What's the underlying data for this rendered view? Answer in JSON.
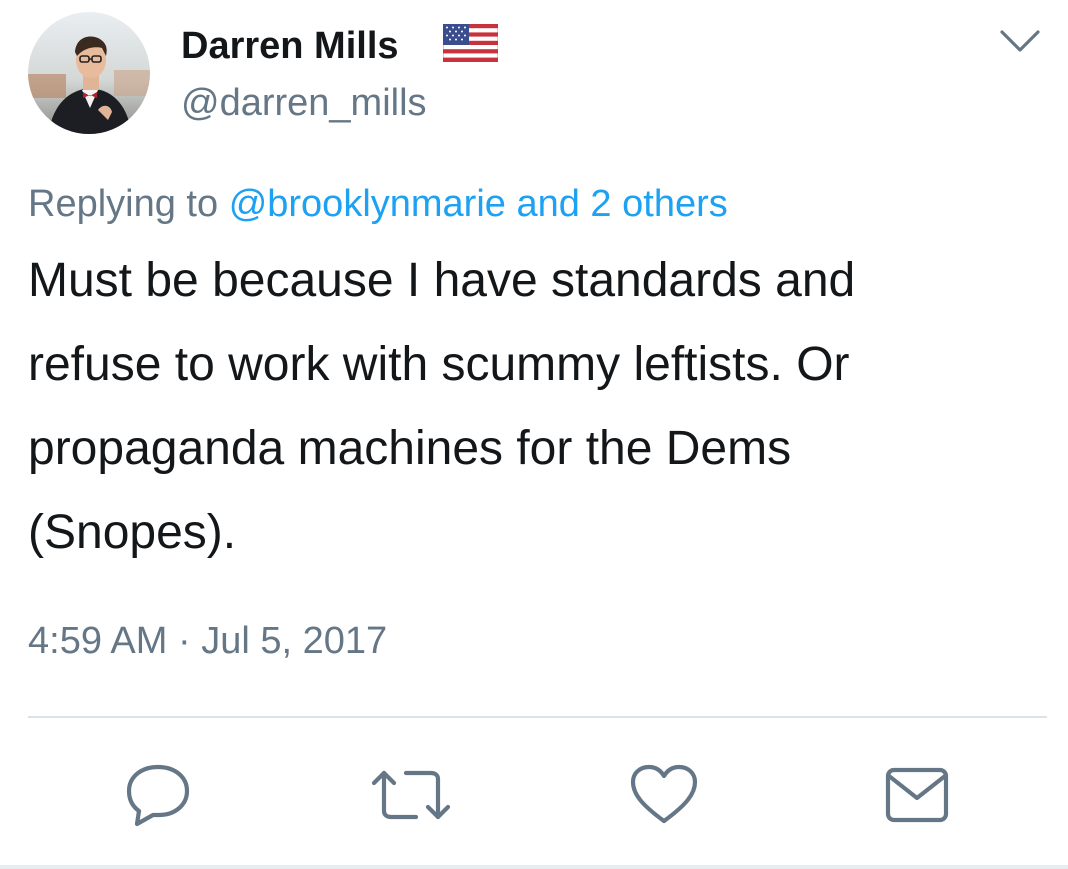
{
  "user": {
    "display_name": "Darren Mills",
    "handle": "@darren_mills",
    "flag_icon": "us-flag-icon"
  },
  "reply": {
    "prefix": "Replying to",
    "mentions": "@brooklynmarie and 2 others"
  },
  "tweet": {
    "lines": [
      "Must be because I have standards and",
      "refuse to work with scummy leftists. Or",
      "propaganda machines for the Dems",
      "(Snopes)."
    ],
    "timestamp": "4:59 AM · Jul 5, 2017"
  },
  "actions": [
    "reply-icon",
    "retweet-icon",
    "like-icon",
    "share-icon"
  ],
  "colors": {
    "text": "#14171a",
    "secondary": "#657786",
    "link": "#1da1f2",
    "icon": "#657786"
  }
}
